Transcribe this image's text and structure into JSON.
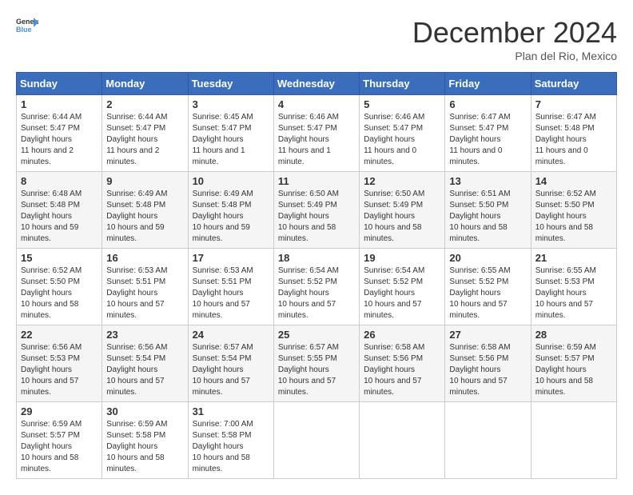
{
  "header": {
    "logo_general": "General",
    "logo_blue": "Blue",
    "month_title": "December 2024",
    "location": "Plan del Rio, Mexico"
  },
  "weekdays": [
    "Sunday",
    "Monday",
    "Tuesday",
    "Wednesday",
    "Thursday",
    "Friday",
    "Saturday"
  ],
  "weeks": [
    [
      {
        "day": "1",
        "sunrise": "6:44 AM",
        "sunset": "5:47 PM",
        "daylight": "11 hours and 2 minutes."
      },
      {
        "day": "2",
        "sunrise": "6:44 AM",
        "sunset": "5:47 PM",
        "daylight": "11 hours and 2 minutes."
      },
      {
        "day": "3",
        "sunrise": "6:45 AM",
        "sunset": "5:47 PM",
        "daylight": "11 hours and 1 minute."
      },
      {
        "day": "4",
        "sunrise": "6:46 AM",
        "sunset": "5:47 PM",
        "daylight": "11 hours and 1 minute."
      },
      {
        "day": "5",
        "sunrise": "6:46 AM",
        "sunset": "5:47 PM",
        "daylight": "11 hours and 0 minutes."
      },
      {
        "day": "6",
        "sunrise": "6:47 AM",
        "sunset": "5:47 PM",
        "daylight": "11 hours and 0 minutes."
      },
      {
        "day": "7",
        "sunrise": "6:47 AM",
        "sunset": "5:48 PM",
        "daylight": "11 hours and 0 minutes."
      }
    ],
    [
      {
        "day": "8",
        "sunrise": "6:48 AM",
        "sunset": "5:48 PM",
        "daylight": "10 hours and 59 minutes."
      },
      {
        "day": "9",
        "sunrise": "6:49 AM",
        "sunset": "5:48 PM",
        "daylight": "10 hours and 59 minutes."
      },
      {
        "day": "10",
        "sunrise": "6:49 AM",
        "sunset": "5:48 PM",
        "daylight": "10 hours and 59 minutes."
      },
      {
        "day": "11",
        "sunrise": "6:50 AM",
        "sunset": "5:49 PM",
        "daylight": "10 hours and 58 minutes."
      },
      {
        "day": "12",
        "sunrise": "6:50 AM",
        "sunset": "5:49 PM",
        "daylight": "10 hours and 58 minutes."
      },
      {
        "day": "13",
        "sunrise": "6:51 AM",
        "sunset": "5:50 PM",
        "daylight": "10 hours and 58 minutes."
      },
      {
        "day": "14",
        "sunrise": "6:52 AM",
        "sunset": "5:50 PM",
        "daylight": "10 hours and 58 minutes."
      }
    ],
    [
      {
        "day": "15",
        "sunrise": "6:52 AM",
        "sunset": "5:50 PM",
        "daylight": "10 hours and 58 minutes."
      },
      {
        "day": "16",
        "sunrise": "6:53 AM",
        "sunset": "5:51 PM",
        "daylight": "10 hours and 57 minutes."
      },
      {
        "day": "17",
        "sunrise": "6:53 AM",
        "sunset": "5:51 PM",
        "daylight": "10 hours and 57 minutes."
      },
      {
        "day": "18",
        "sunrise": "6:54 AM",
        "sunset": "5:52 PM",
        "daylight": "10 hours and 57 minutes."
      },
      {
        "day": "19",
        "sunrise": "6:54 AM",
        "sunset": "5:52 PM",
        "daylight": "10 hours and 57 minutes."
      },
      {
        "day": "20",
        "sunrise": "6:55 AM",
        "sunset": "5:52 PM",
        "daylight": "10 hours and 57 minutes."
      },
      {
        "day": "21",
        "sunrise": "6:55 AM",
        "sunset": "5:53 PM",
        "daylight": "10 hours and 57 minutes."
      }
    ],
    [
      {
        "day": "22",
        "sunrise": "6:56 AM",
        "sunset": "5:53 PM",
        "daylight": "10 hours and 57 minutes."
      },
      {
        "day": "23",
        "sunrise": "6:56 AM",
        "sunset": "5:54 PM",
        "daylight": "10 hours and 57 minutes."
      },
      {
        "day": "24",
        "sunrise": "6:57 AM",
        "sunset": "5:54 PM",
        "daylight": "10 hours and 57 minutes."
      },
      {
        "day": "25",
        "sunrise": "6:57 AM",
        "sunset": "5:55 PM",
        "daylight": "10 hours and 57 minutes."
      },
      {
        "day": "26",
        "sunrise": "6:58 AM",
        "sunset": "5:56 PM",
        "daylight": "10 hours and 57 minutes."
      },
      {
        "day": "27",
        "sunrise": "6:58 AM",
        "sunset": "5:56 PM",
        "daylight": "10 hours and 57 minutes."
      },
      {
        "day": "28",
        "sunrise": "6:59 AM",
        "sunset": "5:57 PM",
        "daylight": "10 hours and 58 minutes."
      }
    ],
    [
      {
        "day": "29",
        "sunrise": "6:59 AM",
        "sunset": "5:57 PM",
        "daylight": "10 hours and 58 minutes."
      },
      {
        "day": "30",
        "sunrise": "6:59 AM",
        "sunset": "5:58 PM",
        "daylight": "10 hours and 58 minutes."
      },
      {
        "day": "31",
        "sunrise": "7:00 AM",
        "sunset": "5:58 PM",
        "daylight": "10 hours and 58 minutes."
      },
      null,
      null,
      null,
      null
    ]
  ]
}
